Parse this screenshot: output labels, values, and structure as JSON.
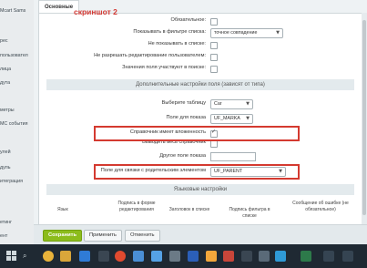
{
  "sidebar": {
    "items": [
      {
        "label": "Мcart Sams"
      },
      {
        "label": "рес"
      },
      {
        "label": "пользовател"
      },
      {
        "label": "лица"
      },
      {
        "label": "дута"
      },
      {
        "label": "метры"
      },
      {
        "label": "МС события"
      },
      {
        "label": "улей"
      },
      {
        "label": "дуль"
      },
      {
        "label": "итеграция"
      },
      {
        "label": "етинг"
      },
      {
        "label": "ент"
      }
    ]
  },
  "tabs": [
    {
      "label": "Основные"
    }
  ],
  "annotation": "скриншот 2",
  "form": {
    "required_label": "Обязательное:",
    "show_filter_label": "Показывать в фильтре списка:",
    "show_filter_value": "точное совпадение",
    "hide_list_label": "Не показывать в списке:",
    "no_edit_label": "Не разрешать редактирование пользователем:",
    "search_label": "Значения поля участвуют в поиске:",
    "section_extra": "Дополнительные настройки поля (зависят от типа)",
    "table_label": "Выберите таблицу",
    "table_value": "Car",
    "display_field_label": "Поле для показа",
    "display_field_value": "UF_MARKA",
    "nested_label": "Справочник имеет вложенность",
    "show_all_label": "Выводить весь справочник",
    "other_field_label": "Другое поле показа",
    "parent_field_label": "Поле для связки с родительским элементом",
    "parent_field_value": "UF_PARENT",
    "section_lang": "Языковые настройки",
    "columns": {
      "lang": "Язык",
      "edit_caption": "Подпись в форме редактирования",
      "list_header": "Заголовок в списке",
      "filter_caption": "Подпись фильтра в списке",
      "error_message": "Сообщение об ошибке (не обязательное)"
    }
  },
  "buttons": {
    "save": "Сохранить",
    "apply": "Применить",
    "cancel": "Отменить"
  },
  "colors": {
    "primary": "#8cbc1c",
    "highlight": "#d43a30",
    "annotation": "#d53a34"
  }
}
